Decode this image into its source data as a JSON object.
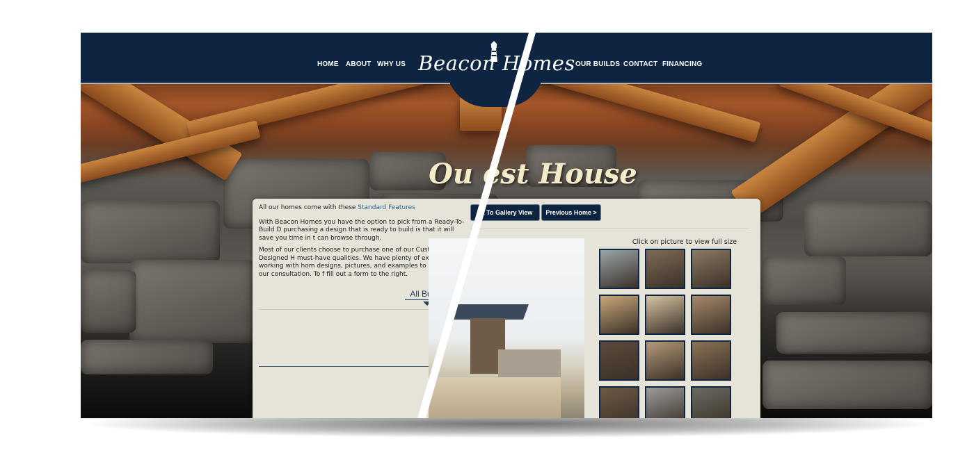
{
  "nav": {
    "left": [
      "HOME",
      "ABOUT",
      "WHY US"
    ],
    "right": [
      "OUR BUILDS",
      "CONTACT",
      "FINANCING"
    ]
  },
  "logo": {
    "text": "Beacon Homes"
  },
  "page_title": "Our Guest House",
  "page_title_visible": "Ou est House",
  "content": {
    "intro_prefix": "All our homes come with these ",
    "intro_link": "Standard Features",
    "para1": "With Beacon Homes you have the option to pick from a Ready-To-Build D purchasing a design that is ready to build is that it will save you time in t can browse through.",
    "para2": "Most of our clients choose to purchase one of our Custom Designed H must-have qualities. We have plenty of experience working with hom designs, pictures, and examples to bring in for our consultation. To f fill out a form to the right.",
    "all_builds": "All Builds"
  },
  "buttons": {
    "back": "ck To Gallery View",
    "previous": "Previous Home >"
  },
  "gallery": {
    "caption": "Click on picture to view full size",
    "thumbs": [
      {
        "name": "thumb-exterior-1",
        "color": "#9aa5a8"
      },
      {
        "name": "thumb-exterior-2",
        "color": "#7d6b55"
      },
      {
        "name": "thumb-exterior-3",
        "color": "#8b7a63"
      },
      {
        "name": "thumb-interior-window-1",
        "color": "#c9a879"
      },
      {
        "name": "thumb-interior-window-2",
        "color": "#d6c3a3"
      },
      {
        "name": "thumb-interior-room-1",
        "color": "#a8896b"
      },
      {
        "name": "thumb-interior-beams",
        "color": "#5c4a3a"
      },
      {
        "name": "thumb-interior-room-2",
        "color": "#b59a78"
      },
      {
        "name": "thumb-interior-doors",
        "color": "#8c7256"
      },
      {
        "name": "thumb-interior-room-3",
        "color": "#6e5a44"
      },
      {
        "name": "thumb-exterior-stone",
        "color": "#9c9c9c"
      },
      {
        "name": "thumb-exterior-porch",
        "color": "#6a6b62"
      }
    ]
  },
  "colors": {
    "header_bg": "#0d2540",
    "panel_bg": "#e6e3d9",
    "link": "#2d6496",
    "title": "#f6ebc8"
  }
}
